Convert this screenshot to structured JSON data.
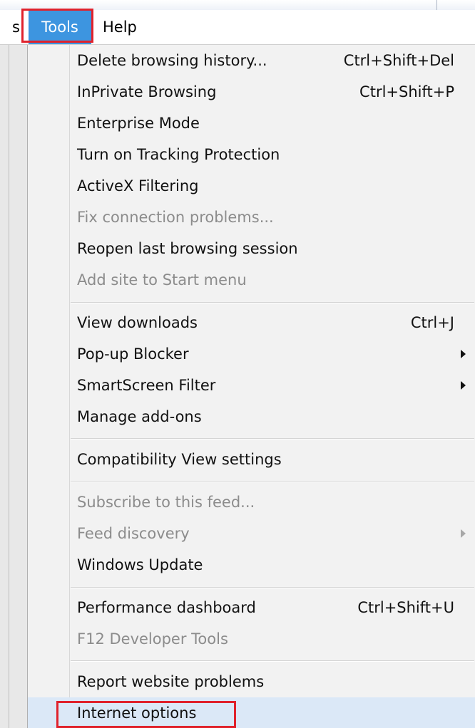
{
  "menubar": {
    "partial_item": "s",
    "tools_label": "Tools",
    "help_label": "Help"
  },
  "menu": {
    "items": [
      {
        "label": "Delete browsing history...",
        "shortcut": "Ctrl+Shift+Del",
        "disabled": false
      },
      {
        "label": "InPrivate Browsing",
        "shortcut": "Ctrl+Shift+P",
        "disabled": false
      },
      {
        "label": "Enterprise Mode",
        "shortcut": "",
        "disabled": false
      },
      {
        "label": "Turn on Tracking Protection",
        "shortcut": "",
        "disabled": false
      },
      {
        "label": "ActiveX Filtering",
        "shortcut": "",
        "disabled": false
      },
      {
        "label": "Fix connection problems...",
        "shortcut": "",
        "disabled": true
      },
      {
        "label": "Reopen last browsing session",
        "shortcut": "",
        "disabled": false
      },
      {
        "label": "Add site to Start menu",
        "shortcut": "",
        "disabled": true
      },
      {
        "label": "View downloads",
        "shortcut": "Ctrl+J",
        "disabled": false
      },
      {
        "label": "Pop-up Blocker",
        "shortcut": "",
        "disabled": false,
        "submenu": true
      },
      {
        "label": "SmartScreen Filter",
        "shortcut": "",
        "disabled": false,
        "submenu": true
      },
      {
        "label": "Manage add-ons",
        "shortcut": "",
        "disabled": false
      },
      {
        "label": "Compatibility View settings",
        "shortcut": "",
        "disabled": false
      },
      {
        "label": "Subscribe to this feed...",
        "shortcut": "",
        "disabled": true
      },
      {
        "label": "Feed discovery",
        "shortcut": "",
        "disabled": true,
        "submenu": true
      },
      {
        "label": "Windows Update",
        "shortcut": "",
        "disabled": false
      },
      {
        "label": "Performance dashboard",
        "shortcut": "Ctrl+Shift+U",
        "disabled": false
      },
      {
        "label": "F12 Developer Tools",
        "shortcut": "",
        "disabled": true
      },
      {
        "label": "Report website problems",
        "shortcut": "",
        "disabled": false
      },
      {
        "label": "Internet options",
        "shortcut": "",
        "disabled": false
      }
    ]
  },
  "colors": {
    "selection_blue": "#3d95e0",
    "highlight_red": "#e0222c",
    "disabled_text": "#8c8c8c"
  }
}
